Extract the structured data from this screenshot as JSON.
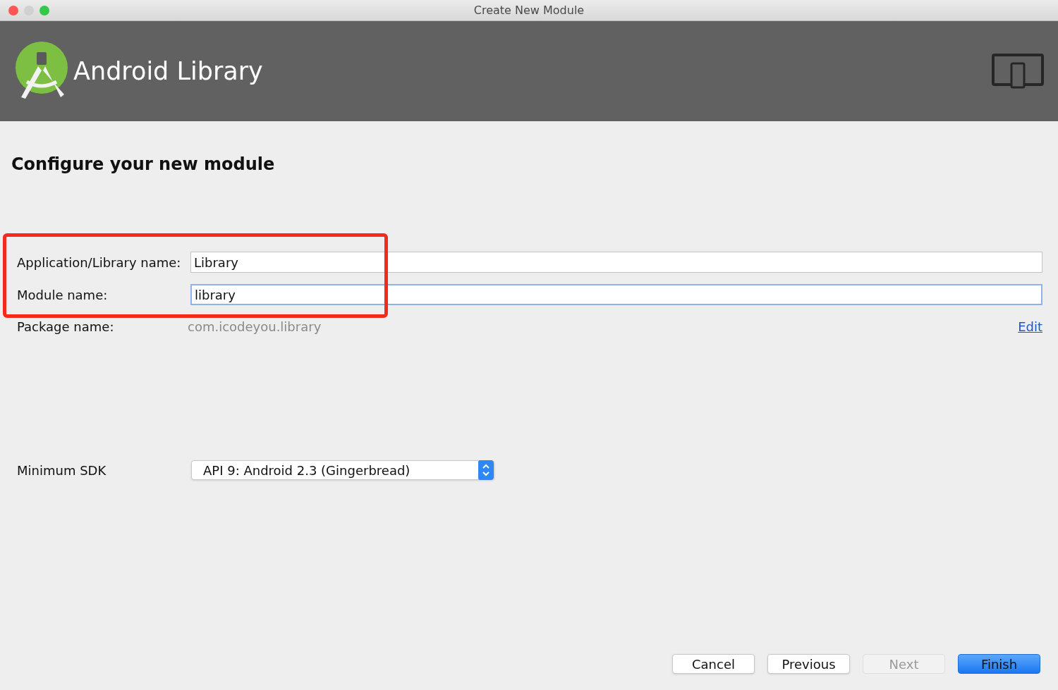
{
  "window": {
    "title": "Create New Module"
  },
  "header": {
    "title": "Android Library"
  },
  "page_title": "Configure your new module",
  "fields": [
    {
      "label": "Application/Library name:",
      "value": "Library",
      "focused": false
    },
    {
      "label": "Module name:",
      "value": "library",
      "focused": true
    }
  ],
  "package": {
    "label": "Package name:",
    "value": "com.icodeyou.library",
    "link": "Edit"
  },
  "min_sdk": {
    "label": "Minimum SDK",
    "value": "API 9: Android 2.3 (Gingerbread)"
  },
  "buttons": [
    {
      "label": "Cancel",
      "disabled": false,
      "default": false
    },
    {
      "label": "Previous",
      "disabled": false,
      "default": false
    },
    {
      "label": "Next",
      "disabled": true,
      "default": false
    },
    {
      "label": "Finish",
      "disabled": false,
      "default": true
    }
  ]
}
